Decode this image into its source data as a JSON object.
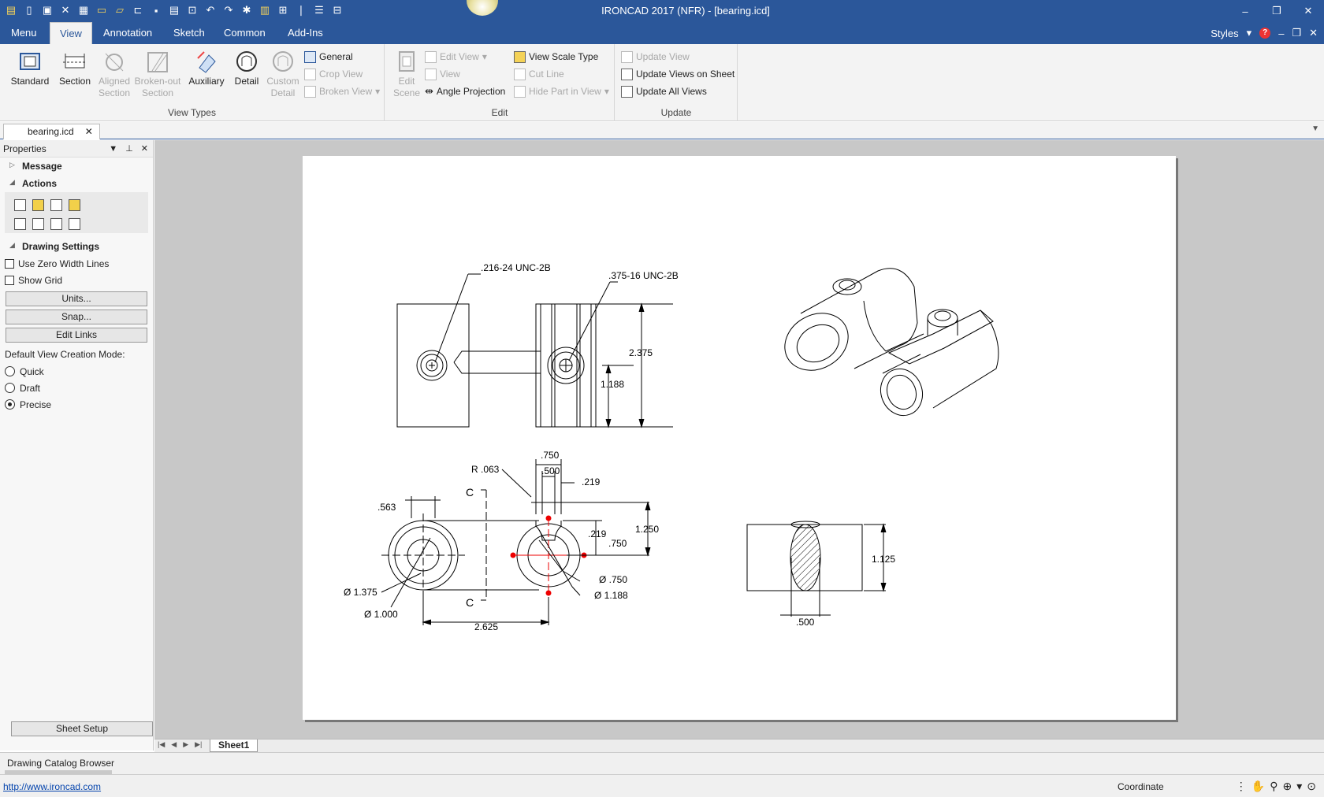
{
  "window": {
    "title": "IRONCAD 2017 (NFR) - [bearing.icd]"
  },
  "menu": {
    "tabs": [
      {
        "label": "Menu"
      },
      {
        "label": "View"
      },
      {
        "label": "Annotation"
      },
      {
        "label": "Sketch"
      },
      {
        "label": "Common"
      },
      {
        "label": "Add-Ins"
      }
    ],
    "styles_label": "Styles"
  },
  "ribbon": {
    "view_types": {
      "label": "View Types",
      "standard": "Standard",
      "section": "Section",
      "aligned_section": "Aligned Section",
      "broken_out_section": "Broken-out Section",
      "auxiliary": "Auxiliary",
      "detail": "Detail",
      "custom_detail": "Custom Detail",
      "general": "General",
      "crop_view": "Crop View",
      "broken_view": "Broken View"
    },
    "edit": {
      "label": "Edit",
      "edit_scene": "Edit Scene",
      "edit_view": "Edit View",
      "view": "View",
      "angle_projection": "Angle Projection",
      "view_scale_type": "View Scale Type",
      "cut_line": "Cut Line",
      "hide_part_in_view": "Hide Part in View"
    },
    "update": {
      "label": "Update",
      "update_view": "Update View",
      "update_views_on_sheet": "Update Views on Sheet",
      "update_all_views": "Update All Views"
    }
  },
  "document_tab": {
    "label": "bearing.icd"
  },
  "properties": {
    "title": "Properties",
    "message": "Message",
    "actions": "Actions",
    "drawing_settings": "Drawing Settings",
    "use_zero_width_lines": "Use Zero Width Lines",
    "show_grid": "Show Grid",
    "units_button": "Units...",
    "snap_button": "Snap...",
    "edit_links_button": "Edit Links",
    "creation_mode_label": "Default View Creation Mode:",
    "mode_quick": "Quick",
    "mode_draft": "Draft",
    "mode_precise": "Precise",
    "selected_mode": "Precise",
    "sheet_setup_button": "Sheet Setup"
  },
  "drawing": {
    "thread_1": ".216-24 UNC-2B",
    "thread_2": ".375-16 UNC-2B",
    "dim_2375": "2.375",
    "dim_1188": "1.188",
    "dim_750_top": ".750",
    "dim_500_top": ".500",
    "dim_r063": "R .063",
    "dim_219_top": ".219",
    "dim_563": ".563",
    "dim_1250": "1.250",
    "dim_219_mid": ".219",
    "dim_750_mid": ".750",
    "dia_1375": "Ø 1.375",
    "dia_1000": "Ø 1.000",
    "dia_750": "Ø .750",
    "dia_1188": "Ø 1.188",
    "dim_2625": "2.625",
    "section_c": "C",
    "dim_1125": "1.125",
    "dim_500_sec": ".500"
  },
  "sheet_tab": {
    "label": "Sheet1"
  },
  "catalog": {
    "label": "Drawing Catalog Browser"
  },
  "status": {
    "link": "http://www.ironcad.com",
    "coordinate": "Coordinate"
  }
}
